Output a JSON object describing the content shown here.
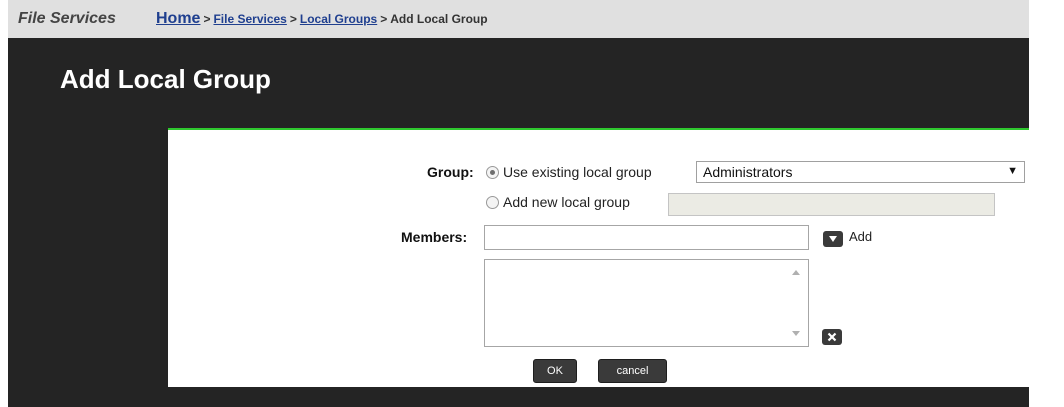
{
  "app": {
    "title": "File Services"
  },
  "breadcrumb": {
    "home": "Home",
    "file_services": "File Services",
    "local_groups": "Local Groups",
    "current": "Add Local Group",
    "separator": ">"
  },
  "page": {
    "title": "Add Local Group"
  },
  "form": {
    "group_label": "Group:",
    "use_existing_label": "Use existing local group",
    "use_existing_selected": true,
    "existing_group_value": "Administrators",
    "add_new_label": "Add new local group",
    "new_group_value": "",
    "members_label": "Members:",
    "members_value": "",
    "add_label": "Add",
    "ok_label": "OK",
    "cancel_label": "cancel"
  },
  "icons": {
    "dropdown_arrow": "▼",
    "add_member": "chevron-down-icon",
    "remove_member": "close-icon"
  },
  "colors": {
    "accent_border": "#2fc82f",
    "page_background": "#242424",
    "button_background": "#3a3a3a"
  }
}
